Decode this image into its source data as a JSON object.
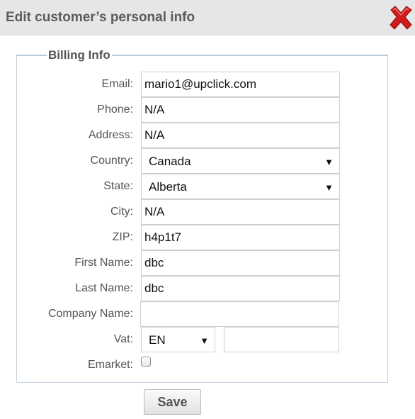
{
  "dialog": {
    "title": "Edit customer’s personal info",
    "close_icon": "close-x-icon",
    "close_color": "#d11a1a"
  },
  "billing": {
    "legend": "Billing Info",
    "email": {
      "label": "Email:",
      "value": "mario1@upclick.com"
    },
    "phone": {
      "label": "Phone:",
      "value": "N/A"
    },
    "address": {
      "label": "Address:",
      "value": "N/A"
    },
    "country": {
      "label": "Country:",
      "value": "Canada"
    },
    "state": {
      "label": "State:",
      "value": "Alberta"
    },
    "city": {
      "label": "City:",
      "value": "N/A"
    },
    "zip": {
      "label": "ZIP:",
      "value": "h4p1t7"
    },
    "first_name": {
      "label": "First Name:",
      "value": "dbc"
    },
    "last_name": {
      "label": "Last Name:",
      "value": "dbc"
    },
    "company_name": {
      "label": "Company Name:",
      "value": ""
    },
    "vat": {
      "label": "Vat:",
      "country_code": "EN",
      "value": ""
    },
    "emarket": {
      "label": "Emarket:",
      "checked": false
    }
  },
  "actions": {
    "save_label": "Save"
  },
  "dropdown_arrow": "▼"
}
